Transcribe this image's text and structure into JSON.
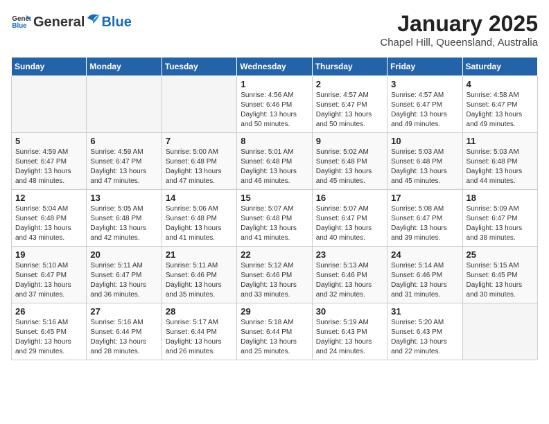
{
  "logo": {
    "text_general": "General",
    "text_blue": "Blue"
  },
  "title": "January 2025",
  "location": "Chapel Hill, Queensland, Australia",
  "weekdays": [
    "Sunday",
    "Monday",
    "Tuesday",
    "Wednesday",
    "Thursday",
    "Friday",
    "Saturday"
  ],
  "weeks": [
    [
      {
        "day": "",
        "empty": true
      },
      {
        "day": "",
        "empty": true
      },
      {
        "day": "",
        "empty": true
      },
      {
        "day": "1",
        "sunrise": "4:56 AM",
        "sunset": "6:46 PM",
        "daylight": "13 hours and 50 minutes."
      },
      {
        "day": "2",
        "sunrise": "4:57 AM",
        "sunset": "6:47 PM",
        "daylight": "13 hours and 50 minutes."
      },
      {
        "day": "3",
        "sunrise": "4:57 AM",
        "sunset": "6:47 PM",
        "daylight": "13 hours and 49 minutes."
      },
      {
        "day": "4",
        "sunrise": "4:58 AM",
        "sunset": "6:47 PM",
        "daylight": "13 hours and 49 minutes."
      }
    ],
    [
      {
        "day": "5",
        "sunrise": "4:59 AM",
        "sunset": "6:47 PM",
        "daylight": "13 hours and 48 minutes."
      },
      {
        "day": "6",
        "sunrise": "4:59 AM",
        "sunset": "6:47 PM",
        "daylight": "13 hours and 47 minutes."
      },
      {
        "day": "7",
        "sunrise": "5:00 AM",
        "sunset": "6:48 PM",
        "daylight": "13 hours and 47 minutes."
      },
      {
        "day": "8",
        "sunrise": "5:01 AM",
        "sunset": "6:48 PM",
        "daylight": "13 hours and 46 minutes."
      },
      {
        "day": "9",
        "sunrise": "5:02 AM",
        "sunset": "6:48 PM",
        "daylight": "13 hours and 45 minutes."
      },
      {
        "day": "10",
        "sunrise": "5:03 AM",
        "sunset": "6:48 PM",
        "daylight": "13 hours and 45 minutes."
      },
      {
        "day": "11",
        "sunrise": "5:03 AM",
        "sunset": "6:48 PM",
        "daylight": "13 hours and 44 minutes."
      }
    ],
    [
      {
        "day": "12",
        "sunrise": "5:04 AM",
        "sunset": "6:48 PM",
        "daylight": "13 hours and 43 minutes."
      },
      {
        "day": "13",
        "sunrise": "5:05 AM",
        "sunset": "6:48 PM",
        "daylight": "13 hours and 42 minutes."
      },
      {
        "day": "14",
        "sunrise": "5:06 AM",
        "sunset": "6:48 PM",
        "daylight": "13 hours and 41 minutes."
      },
      {
        "day": "15",
        "sunrise": "5:07 AM",
        "sunset": "6:48 PM",
        "daylight": "13 hours and 41 minutes."
      },
      {
        "day": "16",
        "sunrise": "5:07 AM",
        "sunset": "6:47 PM",
        "daylight": "13 hours and 40 minutes."
      },
      {
        "day": "17",
        "sunrise": "5:08 AM",
        "sunset": "6:47 PM",
        "daylight": "13 hours and 39 minutes."
      },
      {
        "day": "18",
        "sunrise": "5:09 AM",
        "sunset": "6:47 PM",
        "daylight": "13 hours and 38 minutes."
      }
    ],
    [
      {
        "day": "19",
        "sunrise": "5:10 AM",
        "sunset": "6:47 PM",
        "daylight": "13 hours and 37 minutes."
      },
      {
        "day": "20",
        "sunrise": "5:11 AM",
        "sunset": "6:47 PM",
        "daylight": "13 hours and 36 minutes."
      },
      {
        "day": "21",
        "sunrise": "5:11 AM",
        "sunset": "6:46 PM",
        "daylight": "13 hours and 35 minutes."
      },
      {
        "day": "22",
        "sunrise": "5:12 AM",
        "sunset": "6:46 PM",
        "daylight": "13 hours and 33 minutes."
      },
      {
        "day": "23",
        "sunrise": "5:13 AM",
        "sunset": "6:46 PM",
        "daylight": "13 hours and 32 minutes."
      },
      {
        "day": "24",
        "sunrise": "5:14 AM",
        "sunset": "6:46 PM",
        "daylight": "13 hours and 31 minutes."
      },
      {
        "day": "25",
        "sunrise": "5:15 AM",
        "sunset": "6:45 PM",
        "daylight": "13 hours and 30 minutes."
      }
    ],
    [
      {
        "day": "26",
        "sunrise": "5:16 AM",
        "sunset": "6:45 PM",
        "daylight": "13 hours and 29 minutes."
      },
      {
        "day": "27",
        "sunrise": "5:16 AM",
        "sunset": "6:44 PM",
        "daylight": "13 hours and 28 minutes."
      },
      {
        "day": "28",
        "sunrise": "5:17 AM",
        "sunset": "6:44 PM",
        "daylight": "13 hours and 26 minutes."
      },
      {
        "day": "29",
        "sunrise": "5:18 AM",
        "sunset": "6:44 PM",
        "daylight": "13 hours and 25 minutes."
      },
      {
        "day": "30",
        "sunrise": "5:19 AM",
        "sunset": "6:43 PM",
        "daylight": "13 hours and 24 minutes."
      },
      {
        "day": "31",
        "sunrise": "5:20 AM",
        "sunset": "6:43 PM",
        "daylight": "13 hours and 22 minutes."
      },
      {
        "day": "",
        "empty": true
      }
    ]
  ]
}
